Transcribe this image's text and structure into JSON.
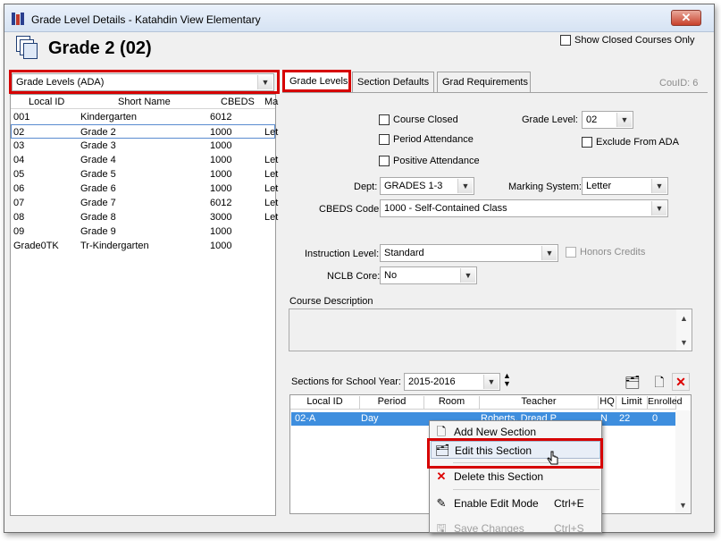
{
  "window": {
    "title": "Grade Level Details - Katahdin View Elementary",
    "close_label": "✕"
  },
  "header": {
    "title": "Grade 2 (02)",
    "show_closed_label": "Show Closed Courses Only"
  },
  "view_selector": {
    "value": "Grade Levels (ADA)"
  },
  "list": {
    "columns": [
      "Local ID",
      "Short Name",
      "CBEDS",
      "Ma"
    ],
    "rows": [
      {
        "id": "001",
        "name": "Kindergarten",
        "cbeds": "6012",
        "ma": ""
      },
      {
        "id": "02",
        "name": "Grade 2",
        "cbeds": "1000",
        "ma": "Let"
      },
      {
        "id": "03",
        "name": "Grade 3",
        "cbeds": "1000",
        "ma": ""
      },
      {
        "id": "04",
        "name": "Grade 4",
        "cbeds": "1000",
        "ma": "Let"
      },
      {
        "id": "05",
        "name": "Grade 5",
        "cbeds": "1000",
        "ma": "Let"
      },
      {
        "id": "06",
        "name": "Grade 6",
        "cbeds": "1000",
        "ma": "Let"
      },
      {
        "id": "07",
        "name": "Grade 7",
        "cbeds": "6012",
        "ma": "Let"
      },
      {
        "id": "08",
        "name": "Grade 8",
        "cbeds": "3000",
        "ma": "Let"
      },
      {
        "id": "09",
        "name": "Grade 9",
        "cbeds": "1000",
        "ma": ""
      },
      {
        "id": "Grade0TK",
        "name": "Tr-Kindergarten",
        "cbeds": "1000",
        "ma": ""
      }
    ]
  },
  "tabs": [
    {
      "label": "Grade Levels"
    },
    {
      "label": "Section Defaults"
    },
    {
      "label": "Grad Requirements"
    }
  ],
  "cou_id": "CouID: 6",
  "form": {
    "course_closed": "Course Closed",
    "period_attendance": "Period Attendance",
    "positive_attendance": "Positive Attendance",
    "grade_level_label": "Grade Level:",
    "grade_level_value": "02",
    "exclude_ada": "Exclude From ADA",
    "dept_label": "Dept:",
    "dept_value": "GRADES 1-3",
    "marking_label": "Marking System:",
    "marking_value": "Letter",
    "cbeds_label": "CBEDS Code:",
    "cbeds_value": "1000 - Self-Contained Class",
    "instruction_label": "Instruction Level:",
    "instruction_value": "Standard",
    "honors_credits": "Honors Credits",
    "nclb_label": "NCLB Core:",
    "nclb_value": "No",
    "description_label": "Course Description"
  },
  "sections": {
    "year_label": "Sections for School Year:",
    "year_value": "2015-2016",
    "columns": [
      "Local ID",
      "Period",
      "Room",
      "Teacher",
      "HQ",
      "Limit",
      "Enrolled"
    ],
    "rows": [
      {
        "id": "02-A",
        "period": "Day",
        "room": "",
        "teacher": "Roberts, Dread P",
        "hq": "N",
        "limit": "22",
        "enrolled": "0"
      }
    ]
  },
  "context_menu": {
    "items": [
      {
        "label": "Add New Section",
        "shortcut": ""
      },
      {
        "label": "Edit this Section",
        "shortcut": ""
      },
      {
        "label": "Delete this Section",
        "shortcut": ""
      },
      {
        "label": "Enable Edit Mode",
        "shortcut": "Ctrl+E"
      },
      {
        "label": "Save Changes",
        "shortcut": "Ctrl+S"
      }
    ]
  },
  "colors": {
    "highlight": "#d60000",
    "selection": "#3e8ede"
  }
}
